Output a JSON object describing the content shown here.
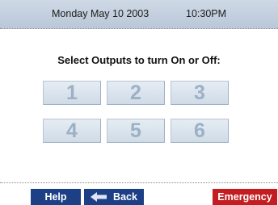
{
  "status": {
    "date": "Monday May 10  2003",
    "time": "10:30PM"
  },
  "instruction": "Select Outputs to turn On or Off:",
  "outputs": [
    "1",
    "2",
    "3",
    "4",
    "5",
    "6"
  ],
  "footer": {
    "help_label": "Help",
    "back_label": "Back",
    "emergency_label": "Emergency"
  },
  "colors": {
    "status_bg": "#c4d0df",
    "button_blue": "#1c3f86",
    "emergency_red": "#c31d22",
    "output_digit": "#9cb0c6"
  },
  "icons": {
    "back": "left-arrow-icon"
  }
}
